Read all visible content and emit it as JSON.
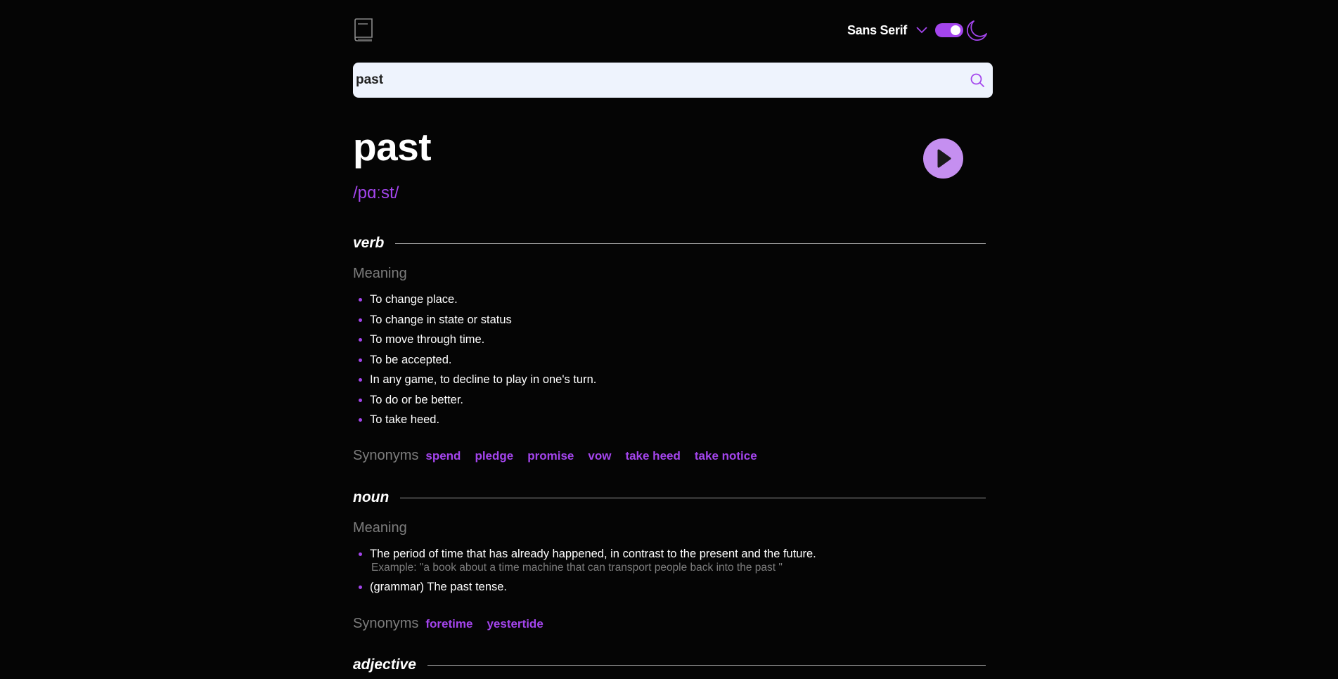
{
  "header": {
    "logo_icon": "book-icon",
    "font_selector": "Sans Serif",
    "chevron_icon": "chevron-down-icon",
    "theme_toggle": "on",
    "moon_icon": "moon-icon",
    "accent_color": "#a445ed"
  },
  "search": {
    "value": "past",
    "icon": "search-icon"
  },
  "entry": {
    "word": "past",
    "phonetic": "/pɑːst/",
    "play_icon": "play-icon"
  },
  "meanings": [
    {
      "part_of_speech": "verb",
      "meaning_label": "Meaning",
      "definitions": [
        {
          "text": "To change place."
        },
        {
          "text": "To change in state or status"
        },
        {
          "text": "To move through time."
        },
        {
          "text": "To be accepted."
        },
        {
          "text": "In any game, to decline to play in one's turn."
        },
        {
          "text": "To do or be better."
        },
        {
          "text": "To take heed."
        }
      ],
      "synonyms_label": "Synonyms",
      "synonyms": [
        "spend",
        "pledge",
        "promise",
        "vow",
        "take heed",
        "take notice"
      ]
    },
    {
      "part_of_speech": "noun",
      "meaning_label": "Meaning",
      "definitions": [
        {
          "text": "The period of time that has already happened, in contrast to the present and the future.",
          "example": "Example: \"a book about a time machine that can transport people back into the past \""
        },
        {
          "text": "(grammar) The past tense."
        }
      ],
      "synonyms_label": "Synonyms",
      "synonyms": [
        "foretime",
        "yestertide"
      ]
    },
    {
      "part_of_speech": "adjective"
    }
  ]
}
